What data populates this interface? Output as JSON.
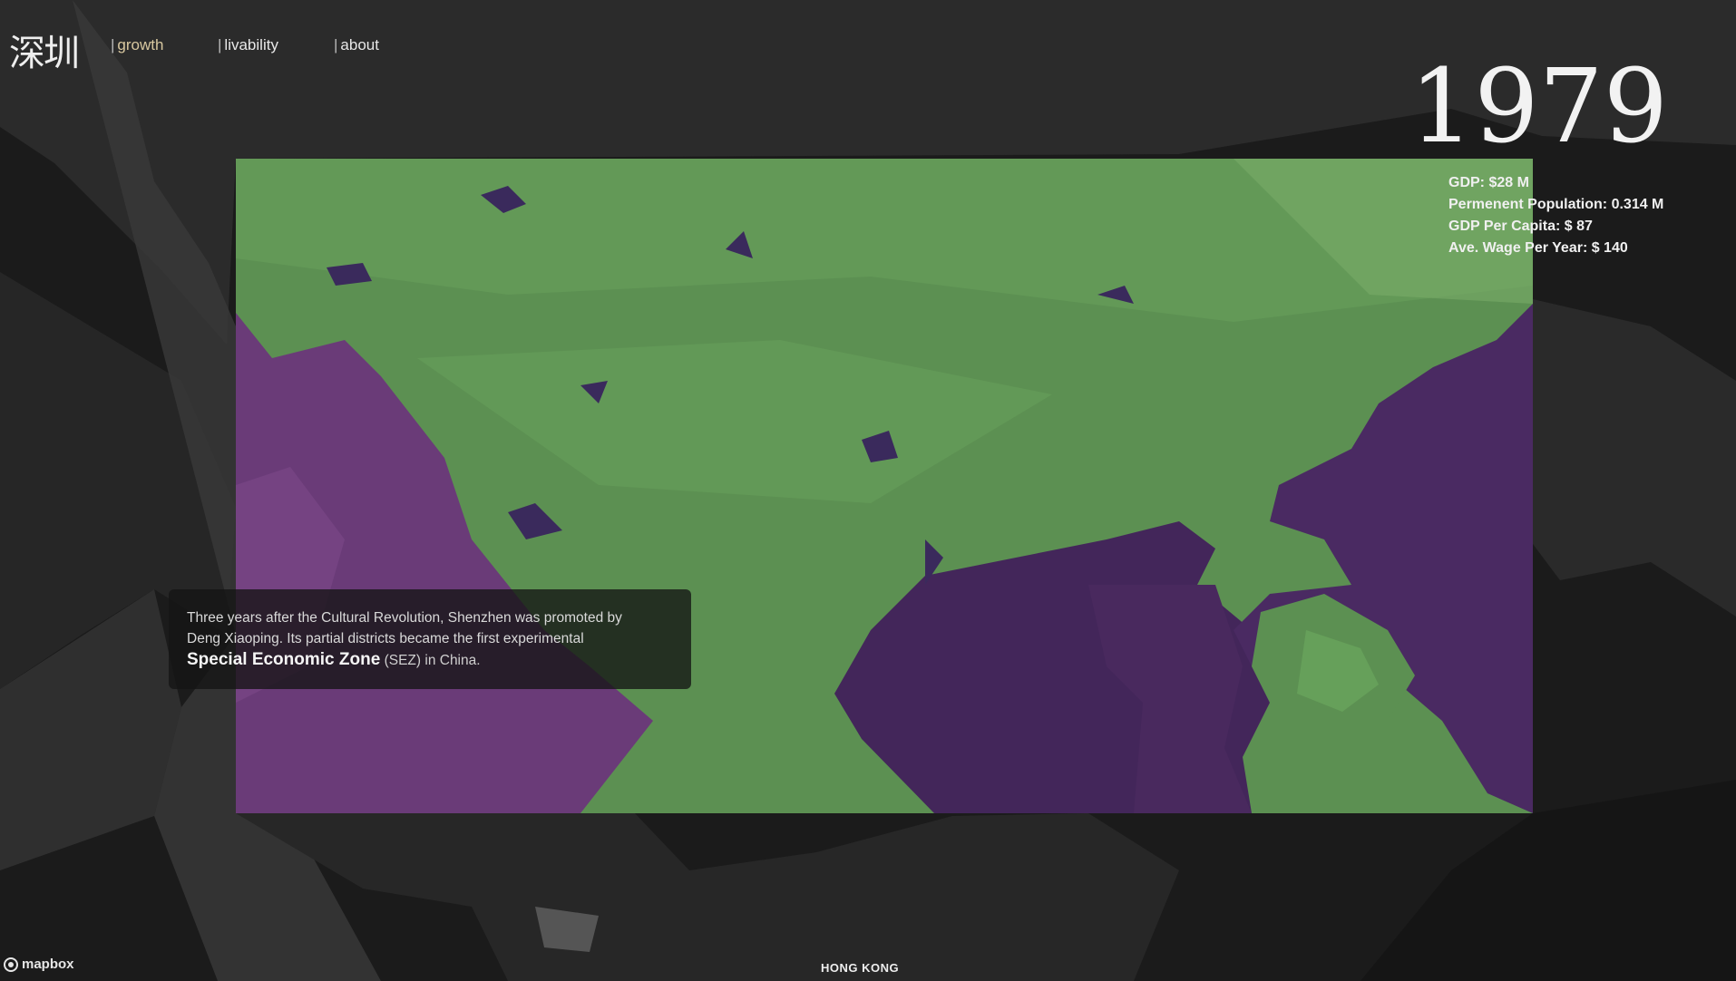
{
  "header": {
    "logo_text": "深圳",
    "nav": [
      {
        "label": "growth",
        "active": true
      },
      {
        "label": "livability",
        "active": false
      },
      {
        "label": "about",
        "active": false
      }
    ],
    "separator": "|"
  },
  "panel": {
    "year": "1979",
    "stats": [
      "GDP: $28 M",
      "Permenent Population: 0.314 M",
      "GDP Per Capita: $ 87",
      "Ave. Wage Per Year: $ 140"
    ]
  },
  "story": {
    "line1": "Three years after the Cultural Revolution, Shenzhen was promoted by",
    "line2": "Deng Xiaoping. Its partial districts became the first experimental",
    "highlight": "Special Economic Zone",
    "abbr": "(SEZ)",
    "tail": "in China."
  },
  "map": {
    "place_label": "HONG KONG",
    "attribution": "mapbox",
    "colors": {
      "land": "#5f9a55",
      "water": "#4a2a5c",
      "base": "#2a2a2a"
    }
  }
}
